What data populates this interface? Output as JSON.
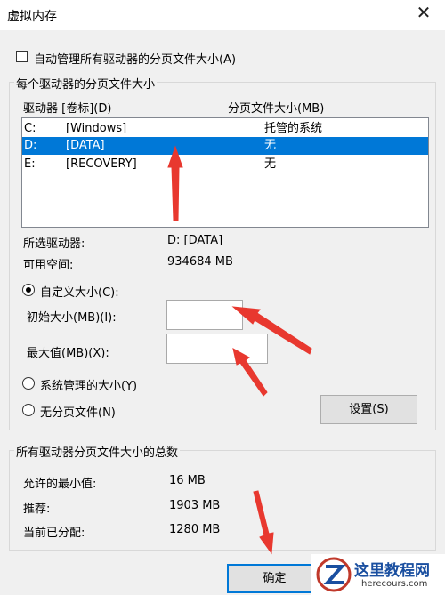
{
  "window": {
    "title": "虚拟内存",
    "close_glyph": "✕"
  },
  "auto_manage": {
    "label": "自动管理所有驱动器的分页文件大小(A)",
    "checked": false
  },
  "per_drive": {
    "legend": "每个驱动器的分页文件大小",
    "col_drive": "驱动器 [卷标](D)",
    "col_size": "分页文件大小(MB)",
    "rows": [
      {
        "drive": "C:",
        "label": "[Windows]",
        "size": "托管的系统"
      },
      {
        "drive": "D:",
        "label": "[DATA]",
        "size": "无"
      },
      {
        "drive": "E:",
        "label": "[RECOVERY]",
        "size": "无"
      }
    ],
    "selected_label": "所选驱动器:",
    "selected_value": "D:  [DATA]",
    "free_label": "可用空间:",
    "free_value": "934684 MB",
    "custom_label": "自定义大小(C):",
    "initial_label": "初始大小(MB)(I):",
    "initial_value": "",
    "max_label": "最大值(MB)(X):",
    "max_value": "",
    "system_label": "系统管理的大小(Y)",
    "none_label": "无分页文件(N)",
    "set_button": "设置(S)"
  },
  "totals": {
    "legend": "所有驱动器分页文件大小的总数",
    "min_label": "允许的最小值:",
    "min_value": "16 MB",
    "rec_label": "推荐:",
    "rec_value": "1903 MB",
    "cur_label": "当前已分配:",
    "cur_value": "1280 MB"
  },
  "ok_button": "确定",
  "watermark": {
    "title": "这里教程网",
    "url": "herecours.com"
  },
  "colors": {
    "selection": "#0078d7",
    "annotation_arrow": "#e8382f"
  }
}
